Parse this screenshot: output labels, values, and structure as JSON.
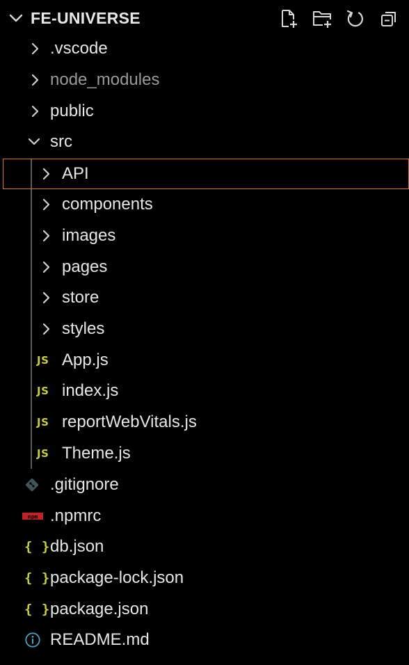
{
  "explorer": {
    "title": "FE-UNIVERSE",
    "actions": {
      "new_file": "new-file-icon",
      "new_folder": "new-folder-icon",
      "refresh": "refresh-icon",
      "collapse_all": "collapse-all-icon"
    },
    "colors": {
      "background": "#000000",
      "selection_border": "#d97a3a",
      "js_badge": "#cbcb41",
      "json_badge": "#cbcb41",
      "npm_badge": "#c12127",
      "info_icon": "#519aba",
      "git_icon": "#41535b"
    }
  },
  "tree": {
    "vscode": {
      "label": ".vscode",
      "type": "folder",
      "expanded": false
    },
    "node_modules": {
      "label": "node_modules",
      "type": "folder",
      "expanded": false
    },
    "public": {
      "label": "public",
      "type": "folder",
      "expanded": false
    },
    "src": {
      "label": "src",
      "type": "folder",
      "expanded": true
    },
    "api": {
      "label": "API",
      "type": "folder",
      "expanded": false,
      "selected": true
    },
    "components": {
      "label": "components",
      "type": "folder",
      "expanded": false
    },
    "images": {
      "label": "images",
      "type": "folder",
      "expanded": false
    },
    "pages": {
      "label": "pages",
      "type": "folder",
      "expanded": false
    },
    "store": {
      "label": "store",
      "type": "folder",
      "expanded": false
    },
    "styles": {
      "label": "styles",
      "type": "folder",
      "expanded": false
    },
    "app_js": {
      "label": "App.js",
      "badge": "JS"
    },
    "index_js": {
      "label": "index.js",
      "badge": "JS"
    },
    "report_js": {
      "label": "reportWebVitals.js",
      "badge": "JS"
    },
    "theme_js": {
      "label": "Theme.js",
      "badge": "JS"
    },
    "gitignore": {
      "label": ".gitignore"
    },
    "npmrc": {
      "label": ".npmrc",
      "badge": "npm"
    },
    "db_json": {
      "label": "db.json",
      "badge": "{ }"
    },
    "pkg_lock": {
      "label": "package-lock.json",
      "badge": "{ }"
    },
    "pkg_json": {
      "label": "package.json",
      "badge": "{ }"
    },
    "readme": {
      "label": "README.md"
    }
  }
}
